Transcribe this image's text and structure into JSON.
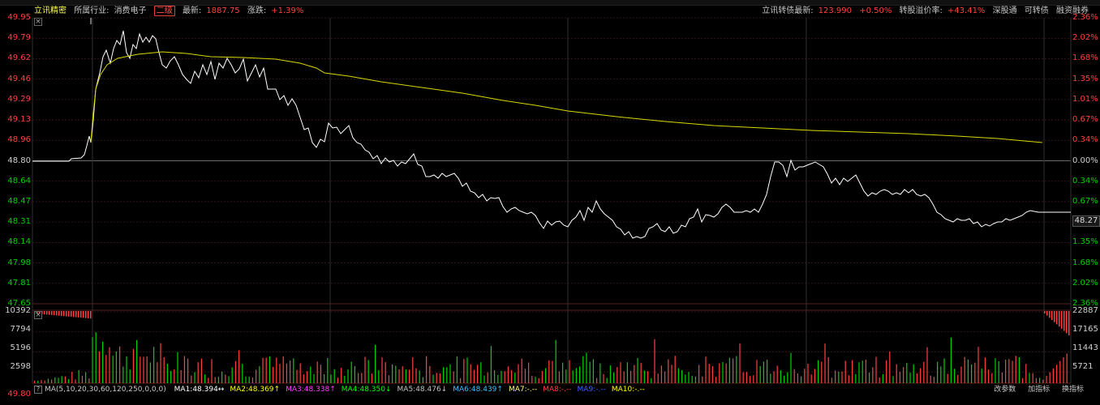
{
  "header": {
    "stock_name": "立讯精密",
    "industry_label": "所属行业:",
    "industry": "消费电子",
    "level_tag": "二级",
    "latest_label": "最新:",
    "latest_value": "1887.75",
    "change_label": "涨跌:",
    "change_value": "+1.39%",
    "bond_label": "立讯转债最新:",
    "bond_value": "123.990",
    "bond_change": "+0.50%",
    "premium_label": "转股溢价率:",
    "premium_value": "+43.41%",
    "btn_connect": "深股通",
    "btn_convertible": "可转债",
    "btn_margin": "融资融券"
  },
  "price_axis_left": [
    "49.95",
    "49.79",
    "49.62",
    "49.46",
    "49.29",
    "49.13",
    "48.96",
    "48.80",
    "48.64",
    "48.47",
    "48.31",
    "48.14",
    "47.98",
    "47.81",
    "47.65"
  ],
  "price_axis_right": [
    "2.36%",
    "2.02%",
    "1.68%",
    "1.35%",
    "1.01%",
    "0.67%",
    "0.34%",
    "0.00%",
    "0.34%",
    "0.67%",
    "1.01%",
    "1.35%",
    "1.68%",
    "2.02%",
    "2.36%"
  ],
  "current_price_tag": "48.27",
  "volume_axis_left": [
    "10392",
    "7794",
    "5196",
    "2598"
  ],
  "volume_axis_right": [
    "22887",
    "17165",
    "11443",
    "5721"
  ],
  "bottom_left_value": "49.80",
  "colors": {
    "up": "#ff4040",
    "down": "#00d000",
    "price_line": "#ffffff",
    "avg_line": "#d8d800",
    "grid": "#3a1c1c"
  },
  "ma": {
    "params": "MA(5,10,20,30,60,120,250,0,0,0)",
    "items": [
      {
        "text": "MA1:48.394↔",
        "color": "#ffffff"
      },
      {
        "text": "MA2:48.369↑",
        "color": "#ffff00"
      },
      {
        "text": "MA3:48.338↑",
        "color": "#ff40ff"
      },
      {
        "text": "MA4:48.350↓",
        "color": "#00ff00"
      },
      {
        "text": "MA5:48.476↓",
        "color": "#c0c0c0"
      },
      {
        "text": "MA6:48.439↑",
        "color": "#40c0ff"
      },
      {
        "text": "MA7:-.--",
        "color": "#ffff80"
      },
      {
        "text": "MA8:-.--",
        "color": "#ff4040"
      },
      {
        "text": "MA9:-.--",
        "color": "#4060ff"
      },
      {
        "text": "MA10:-.--",
        "color": "#ffff00"
      }
    ],
    "btn_params": "改参数",
    "btn_add": "加指标",
    "btn_switch": "换指标"
  }
}
